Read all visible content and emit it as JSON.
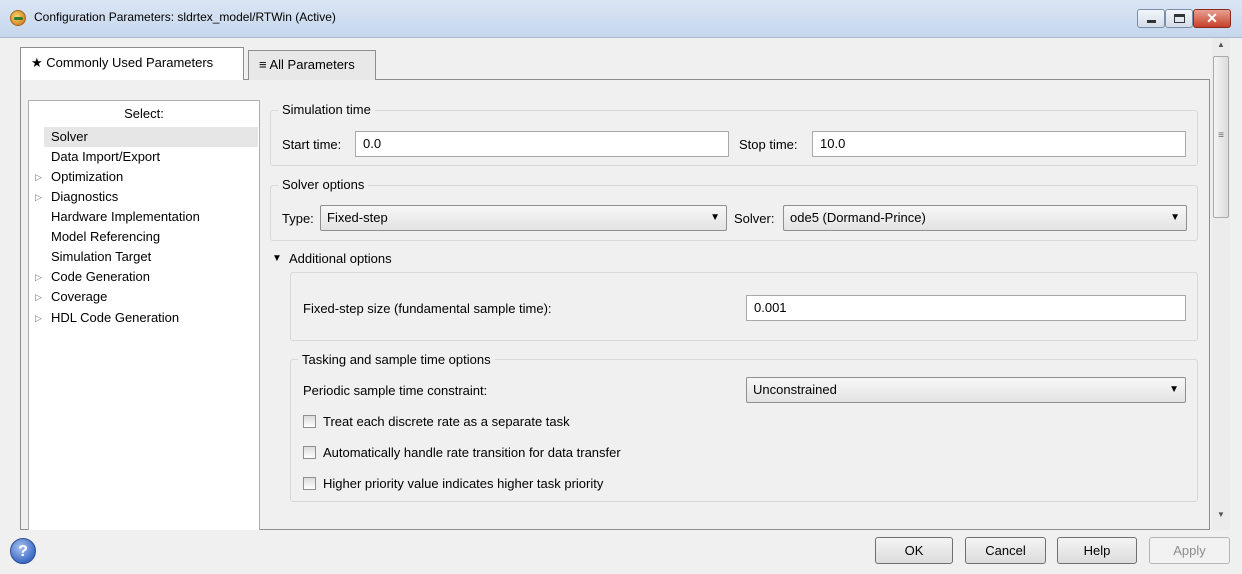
{
  "window": {
    "title": "Configuration Parameters: sldrtex_model/RTWin (Active)",
    "minimize_icon": "minimize-icon",
    "maximize_icon": "maximize-icon",
    "close_icon": "close-icon",
    "close_color": "#c6402a"
  },
  "tabs": [
    {
      "icon": "★",
      "label": "Commonly Used Parameters",
      "active": true
    },
    {
      "icon": "≡",
      "label": "All Parameters",
      "active": false
    }
  ],
  "sidebar": {
    "header": "Select:",
    "items": [
      {
        "label": "Solver",
        "expandable": false,
        "selected": true
      },
      {
        "label": "Data Import/Export",
        "expandable": false
      },
      {
        "label": "Optimization",
        "expandable": true
      },
      {
        "label": "Diagnostics",
        "expandable": true
      },
      {
        "label": "Hardware Implementation",
        "expandable": false
      },
      {
        "label": "Model Referencing",
        "expandable": false
      },
      {
        "label": "Simulation Target",
        "expandable": false
      },
      {
        "label": "Code Generation",
        "expandable": true
      },
      {
        "label": "Coverage",
        "expandable": true
      },
      {
        "label": "HDL Code Generation",
        "expandable": true
      }
    ]
  },
  "simulation_time": {
    "title": "Simulation time",
    "start_label": "Start time:",
    "start_value": "0.0",
    "stop_label": "Stop time:",
    "stop_value": "10.0"
  },
  "solver_options": {
    "title": "Solver options",
    "type_label": "Type:",
    "type_value": "Fixed-step",
    "solver_label": "Solver:",
    "solver_value": "ode5 (Dormand-Prince)"
  },
  "additional_options": {
    "toggle": "▼",
    "title": "Additional options",
    "step_size_label": "Fixed-step size (fundamental sample time):",
    "step_size_value": "0.001"
  },
  "tasking": {
    "title": "Tasking and sample time options",
    "constraint_label": "Periodic sample time constraint:",
    "constraint_value": "Unconstrained",
    "checkboxes": [
      {
        "label": "Treat each discrete rate as a separate task",
        "checked": false
      },
      {
        "label": "Automatically handle rate transition for data transfer",
        "checked": false
      },
      {
        "label": "Higher priority value indicates higher task priority",
        "checked": false
      }
    ]
  },
  "buttons": {
    "ok": "OK",
    "cancel": "Cancel",
    "help": "Help",
    "apply": "Apply",
    "help_icon": "?"
  }
}
